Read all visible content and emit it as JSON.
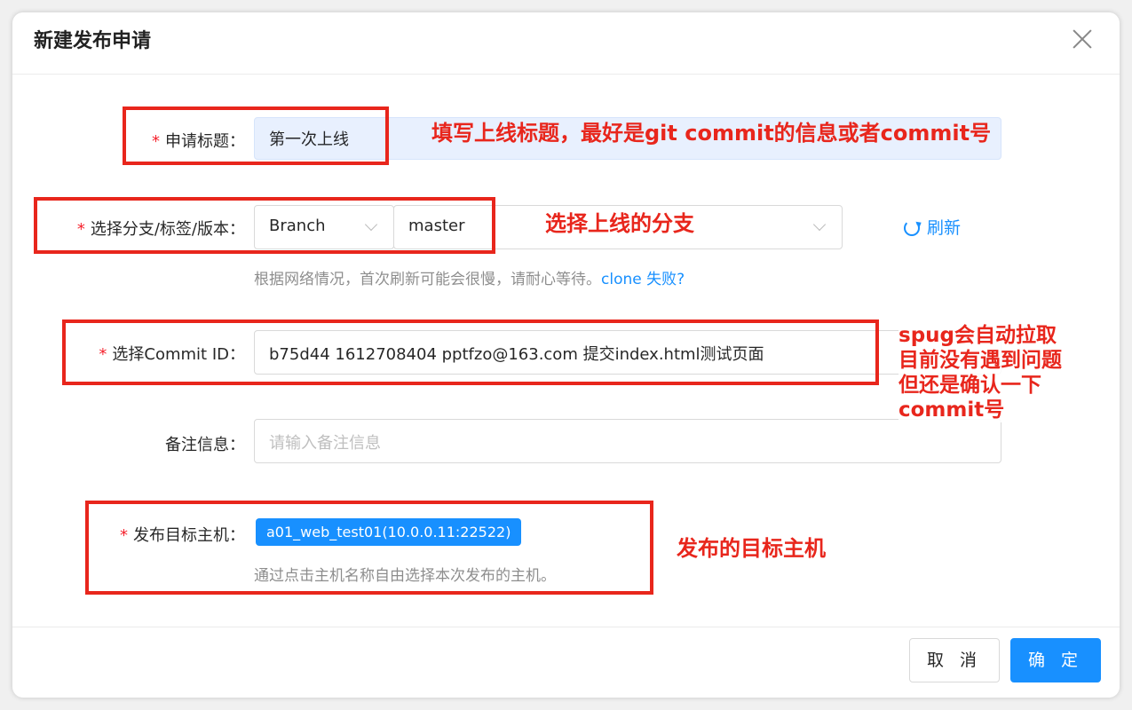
{
  "modal": {
    "title": "新建发布申请"
  },
  "form": {
    "title_field": {
      "label": "申请标题：",
      "value": "第一次上线"
    },
    "branch_field": {
      "label": "选择分支/标签/版本：",
      "type_value": "Branch",
      "branch_value": "master",
      "refresh_label": "刷新",
      "help_text": "根据网络情况，首次刷新可能会很慢，请耐心等待。",
      "help_link": "clone 失败?"
    },
    "commit_field": {
      "label": "选择Commit ID：",
      "value": "b75d44 1612708404 pptfzo@163.com 提交index.html测试页面"
    },
    "remark_field": {
      "label": "备注信息：",
      "placeholder": "请输入备注信息"
    },
    "hosts_field": {
      "label": "发布目标主机：",
      "selected_host": "a01_web_test01(10.0.0.11:22522)",
      "help_text": "通过点击主机名称自由选择本次发布的主机。"
    }
  },
  "footer": {
    "cancel_label": "取 消",
    "ok_label": "确 定"
  },
  "annotations": {
    "title_note": "填写上线标题，最好是git commit的信息或者commit号",
    "branch_note": "选择上线的分支",
    "commit_note_lines": [
      "spug会自动拉取",
      "目前没有遇到问题",
      "但还是确认一下",
      "commit号"
    ],
    "host_note": "发布的目标主机"
  },
  "colors": {
    "primary": "#1890ff",
    "required": "#f5222d",
    "annotation_red": "#e8261c"
  }
}
